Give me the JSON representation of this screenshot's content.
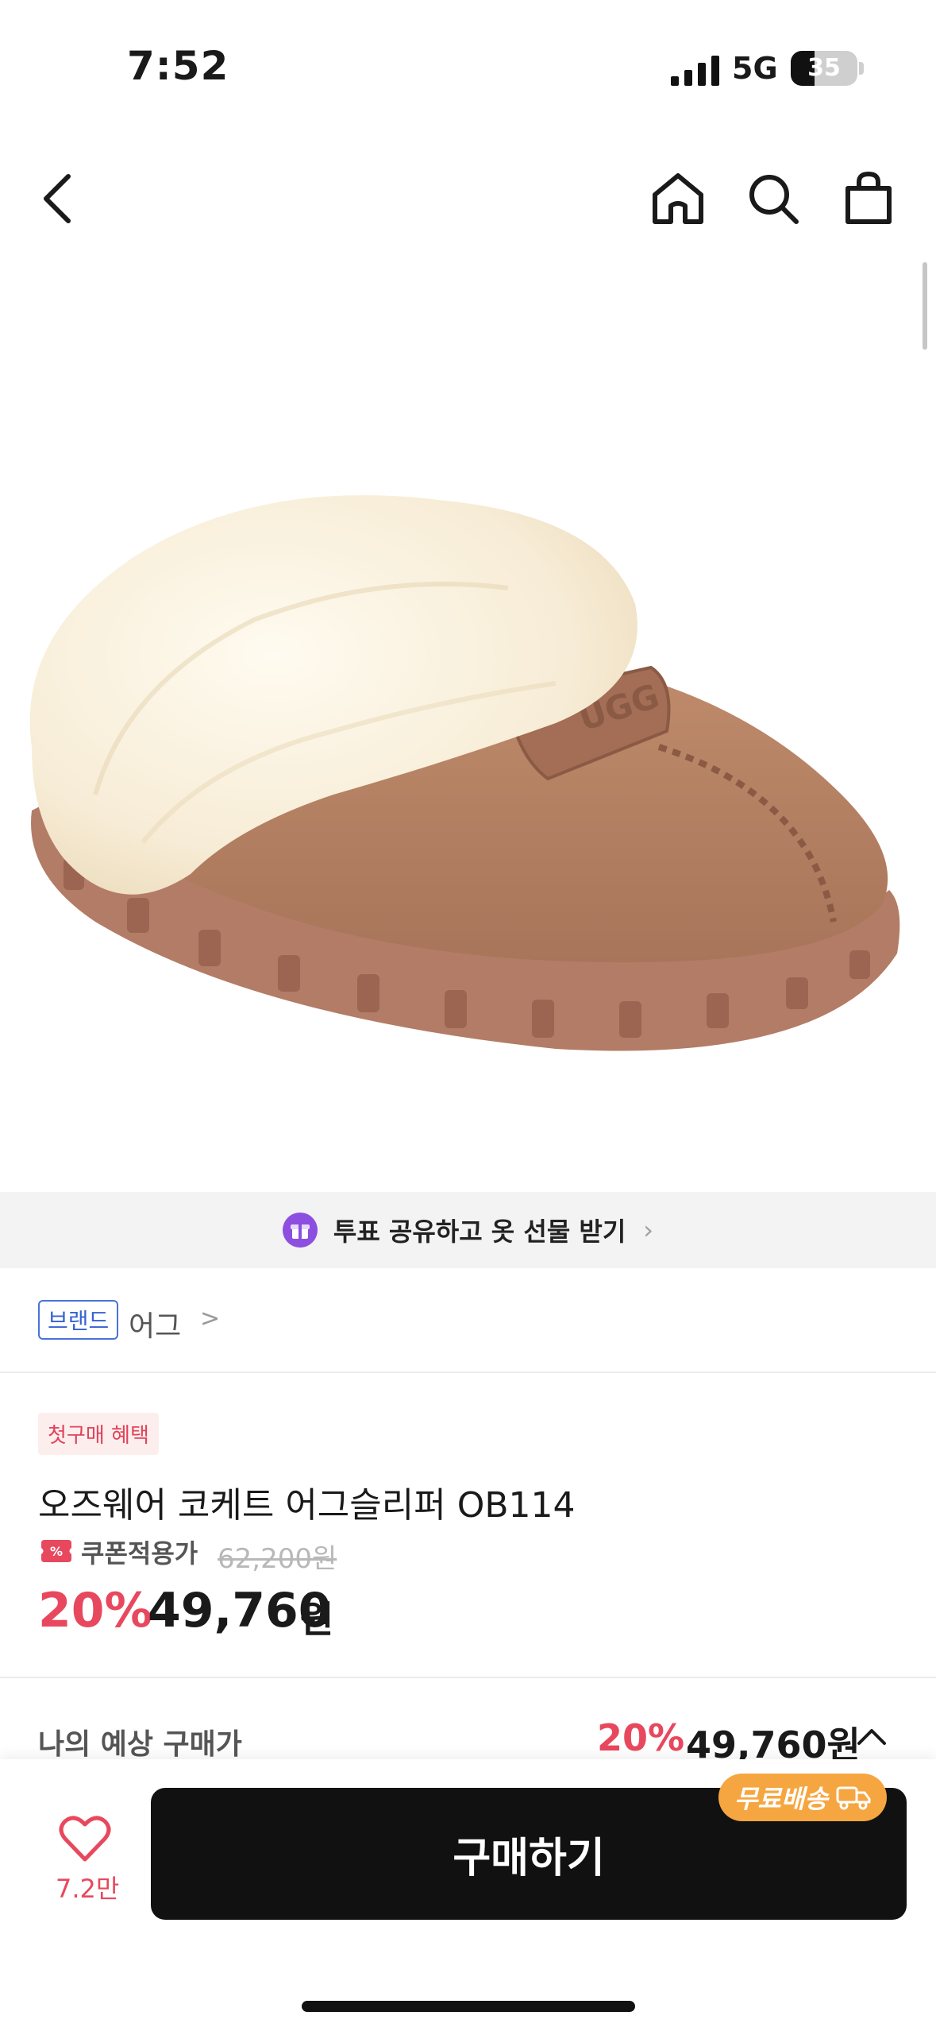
{
  "status_bar": {
    "time": "7:52",
    "network": "5G",
    "battery": "35"
  },
  "nav": {
    "icons": [
      "back-icon",
      "home-icon",
      "search-icon",
      "shopping-bag-icon"
    ]
  },
  "promo_banner": {
    "text": "투표 공유하고 옷 선물 받기",
    "icon": "gift-icon",
    "color": "#8c4fe0"
  },
  "brand": {
    "tag": "브랜드",
    "name": "어그",
    "chevron": ">"
  },
  "product": {
    "badge": "첫구매 혜택",
    "title": "오즈웨어 코케트 어그슬리퍼 OB114",
    "coupon_label": "쿠폰적용가",
    "original_price": "62,200원",
    "discount": "20%",
    "price": "49,760",
    "currency": "원"
  },
  "expected": {
    "label": "나의 예상 구매가",
    "discount": "20%",
    "price": "49,760원"
  },
  "bottom_bar": {
    "like_count": "7.2만",
    "buy_label": "구매하기",
    "shipping_badge": "무료배송"
  },
  "colors": {
    "accent": "#e8485e",
    "brand_blue": "#3662d0",
    "shipping": "#f6a640",
    "button": "#111111"
  }
}
